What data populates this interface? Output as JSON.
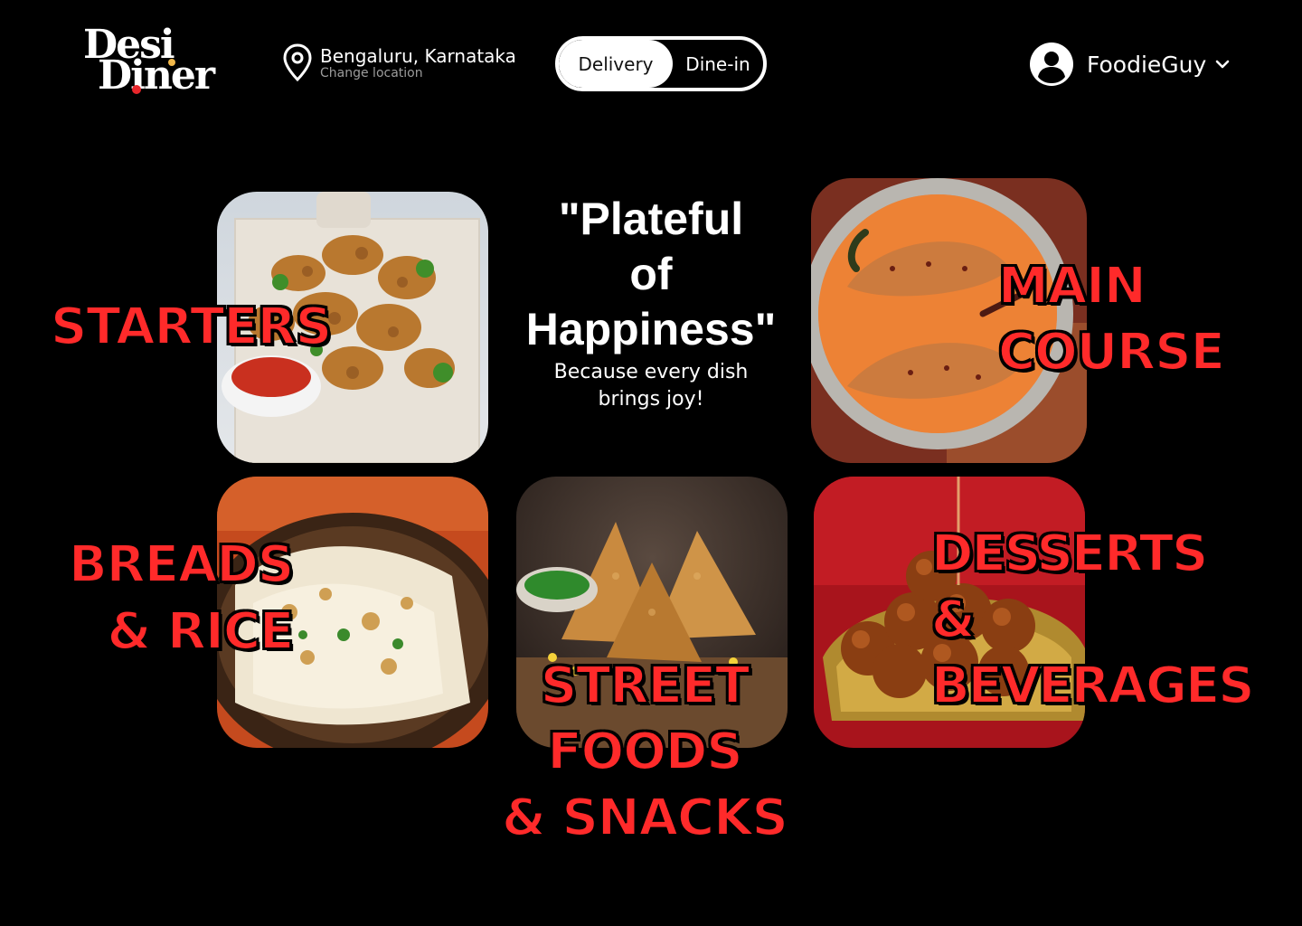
{
  "brand": {
    "logo_line1": "Desi",
    "logo_line2": "Diner",
    "accent_red": "#e8262b",
    "accent_gold": "#f2b84b"
  },
  "location": {
    "icon": "map-pin-icon",
    "city": "Bengaluru, Karnataka",
    "change_label": "Change location"
  },
  "order_mode": {
    "options": [
      "Delivery",
      "Dine-in"
    ],
    "selected": "Delivery"
  },
  "user": {
    "icon": "user-circle-icon",
    "name": "FoodieGuy",
    "menu_icon": "chevron-down-icon"
  },
  "tagline": {
    "title": "\"Plateful\nof\nHappiness\"",
    "subtitle": "Because every dish brings joy!"
  },
  "categories": [
    {
      "label": "STARTERS",
      "image": "pakora-platter"
    },
    {
      "label": "MAIN\nCOURSE",
      "image": "fish-curry"
    },
    {
      "label": "BREADS\n& RICE",
      "image": "naan-basket"
    },
    {
      "label": "STREET\nFOODS\n& SNACKS",
      "image": "samosas"
    },
    {
      "label": "DESSERTS\n&\nBEVERAGES",
      "image": "gulab-jamun"
    }
  ],
  "colors": {
    "background": "#000000",
    "label_red": "#ff2a2a"
  }
}
